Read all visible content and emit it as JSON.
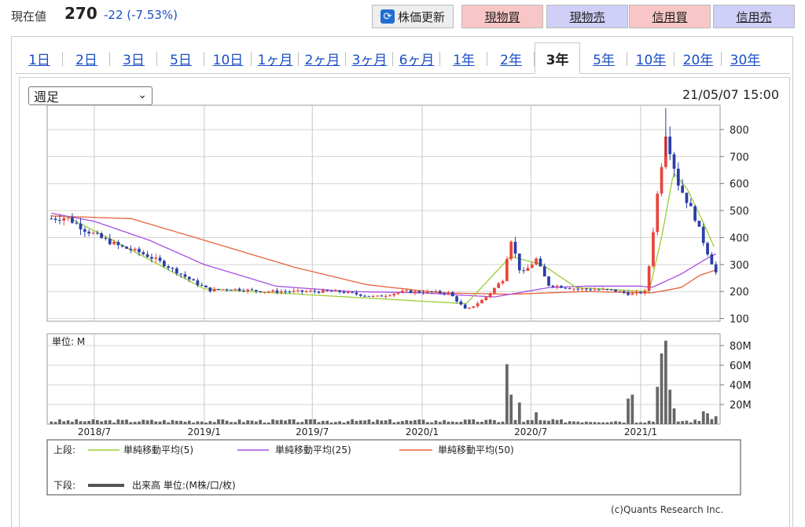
{
  "header": {
    "price_label": "現在値",
    "price_value": "270",
    "change": "-22 (-7.53%)",
    "refresh_label": "株価更新",
    "buttons": [
      "現物買",
      "現物売",
      "信用買",
      "信用売"
    ],
    "colors": {
      "buy": "#f8c6c6",
      "sell": "#cfcff8",
      "change": "#1a4fc4"
    }
  },
  "tabs": [
    "1日",
    "2日",
    "3日",
    "5日",
    "10日",
    "1ヶ月",
    "2ヶ月",
    "3ヶ月",
    "6ヶ月",
    "1年",
    "2年",
    "3年",
    "5年",
    "10年",
    "20年",
    "30年"
  ],
  "active_tab": "3年",
  "period_select": {
    "value": "週足"
  },
  "timestamp": "21/05/07 15:00",
  "legend": {
    "upper_label": "上段:",
    "lower_label": "下段:",
    "items": [
      "単純移動平均(5)",
      "単純移動平均(25)",
      "単純移動平均(50)"
    ],
    "volume_text": "出来高 単位:(M株/口/枚)"
  },
  "volume_unit_label": "単位: M",
  "credit": "(c)Quants Research Inc.",
  "chart_data": [
    {
      "type": "candlestick",
      "interval": "weekly",
      "yaxis_ticks": [
        100,
        200,
        300,
        400,
        500,
        600,
        700,
        800
      ],
      "ylim": [
        90,
        890
      ],
      "xlim": [
        "2018-04-13",
        "2021-05-14"
      ],
      "x_ticks": [
        "2018/7",
        "2019/1",
        "2019/7",
        "2020/1",
        "2020/7",
        "2021/1"
      ],
      "grid": true,
      "colors": {
        "up": "#e8453c",
        "down": "#2b3fa8",
        "ma5": "#9acd32",
        "ma25": "#a94ee0",
        "ma50": "#e6653b"
      },
      "anchors": [
        [
          "2018-04-20",
          470
        ],
        [
          "2018-05-15",
          475
        ],
        [
          "2018-06-15",
          430
        ],
        [
          "2018-07-15",
          395
        ],
        [
          "2018-08-15",
          365
        ],
        [
          "2018-09-15",
          345
        ],
        [
          "2018-10-15",
          315
        ],
        [
          "2018-11-15",
          275
        ],
        [
          "2018-12-15",
          235
        ],
        [
          "2019-01-10",
          205
        ],
        [
          "2019-02-15",
          210
        ],
        [
          "2019-03-15",
          205
        ],
        [
          "2019-04-15",
          200
        ],
        [
          "2019-06-15",
          200
        ],
        [
          "2019-08-15",
          200
        ],
        [
          "2019-10-15",
          180
        ],
        [
          "2019-12-01",
          200
        ],
        [
          "2020-01-15",
          198
        ],
        [
          "2020-02-15",
          195
        ],
        [
          "2020-03-15",
          130
        ],
        [
          "2020-04-15",
          175
        ],
        [
          "2020-05-15",
          245
        ],
        [
          "2020-05-28",
          400
        ],
        [
          "2020-06-15",
          260
        ],
        [
          "2020-07-10",
          320
        ],
        [
          "2020-07-30",
          225
        ],
        [
          "2020-09-15",
          210
        ],
        [
          "2020-11-15",
          205
        ],
        [
          "2020-12-15",
          190
        ],
        [
          "2021-01-10",
          200
        ],
        [
          "2021-01-29",
          560
        ],
        [
          "2021-02-12",
          790
        ],
        [
          "2021-03-05",
          600
        ],
        [
          "2021-04-01",
          480
        ],
        [
          "2021-04-20",
          360
        ],
        [
          "2021-05-07",
          270
        ]
      ],
      "ma5_anchors": [
        [
          "2018-05-15",
          478
        ],
        [
          "2018-08-01",
          390
        ],
        [
          "2019-01-01",
          210
        ],
        [
          "2020-03-15",
          155
        ],
        [
          "2020-05-28",
          330
        ],
        [
          "2020-07-20",
          300
        ],
        [
          "2020-09-15",
          215
        ],
        [
          "2021-01-15",
          200
        ],
        [
          "2021-02-05",
          400
        ],
        [
          "2021-02-25",
          640
        ],
        [
          "2021-03-20",
          580
        ],
        [
          "2021-04-15",
          460
        ],
        [
          "2021-05-07",
          350
        ]
      ],
      "ma25_anchors": [
        [
          "2018-04-20",
          490
        ],
        [
          "2018-07-01",
          460
        ],
        [
          "2018-10-01",
          390
        ],
        [
          "2019-01-01",
          300
        ],
        [
          "2019-05-01",
          220
        ],
        [
          "2019-09-01",
          200
        ],
        [
          "2020-01-01",
          195
        ],
        [
          "2020-05-01",
          180
        ],
        [
          "2020-08-01",
          215
        ],
        [
          "2020-10-01",
          220
        ],
        [
          "2021-01-01",
          220
        ],
        [
          "2021-01-20",
          215
        ],
        [
          "2021-03-10",
          265
        ],
        [
          "2021-04-20",
          320
        ],
        [
          "2021-05-07",
          340
        ]
      ],
      "ma50_anchors": [
        [
          "2018-04-20",
          480
        ],
        [
          "2018-09-01",
          470
        ],
        [
          "2019-01-01",
          390
        ],
        [
          "2019-06-01",
          290
        ],
        [
          "2019-10-01",
          225
        ],
        [
          "2020-02-01",
          195
        ],
        [
          "2020-06-01",
          190
        ],
        [
          "2020-10-01",
          200
        ],
        [
          "2021-01-20",
          195
        ],
        [
          "2021-03-10",
          215
        ],
        [
          "2021-04-10",
          260
        ],
        [
          "2021-05-07",
          280
        ]
      ]
    },
    {
      "type": "bar",
      "series_name": "出来高",
      "unit": "M",
      "yaxis_ticks": [
        20,
        40,
        60,
        80
      ],
      "ylim": [
        0,
        92
      ],
      "peaks": [
        [
          "2020-05-22",
          61
        ],
        [
          "2020-05-29",
          30
        ],
        [
          "2020-06-12",
          22
        ],
        [
          "2020-07-10",
          12
        ],
        [
          "2020-12-11",
          26
        ],
        [
          "2020-12-18",
          30
        ],
        [
          "2021-01-29",
          38
        ],
        [
          "2021-02-05",
          72
        ],
        [
          "2021-02-12",
          85
        ],
        [
          "2021-02-19",
          35
        ],
        [
          "2021-02-26",
          16
        ],
        [
          "2021-04-16",
          13
        ],
        [
          "2021-04-23",
          11
        ],
        [
          "2021-05-07",
          8
        ]
      ],
      "baseline": 3
    }
  ]
}
